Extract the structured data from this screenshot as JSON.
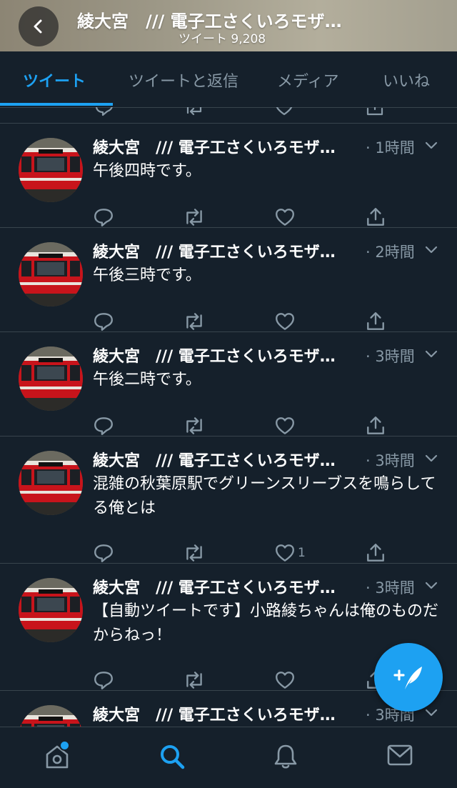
{
  "header": {
    "title": "綾大宮　/// 電子工さくいろモザ…",
    "subtitle": "ツイート 9,208"
  },
  "tabs": [
    {
      "label": "ツイート",
      "active": true
    },
    {
      "label": "ツイートと返信",
      "active": false
    },
    {
      "label": "メディア",
      "active": false
    },
    {
      "label": "いいね",
      "active": false
    }
  ],
  "tweets": [
    {
      "name": "綾大宮　/// 電子工さくいろモザ…",
      "time": "· 1時間",
      "text": "午後四時です。",
      "likes": ""
    },
    {
      "name": "綾大宮　/// 電子工さくいろモザ…",
      "time": "· 2時間",
      "text": "午後三時です。",
      "likes": ""
    },
    {
      "name": "綾大宮　/// 電子工さくいろモザ…",
      "time": "· 3時間",
      "text": "午後二時です。",
      "likes": ""
    },
    {
      "name": "綾大宮　/// 電子工さくいろモザ…",
      "time": "· 3時間",
      "text": "混雑の秋葉原駅でグリーンスリーブスを鳴らしてる俺とは",
      "likes": "1"
    },
    {
      "name": "綾大宮　/// 電子工さくいろモザ…",
      "time": "· 3時間",
      "text": "【自動ツイートです】小路綾ちゃんは俺のものだからねっ！",
      "likes": ""
    },
    {
      "name": "綾大宮　/// 電子工さくいろモザ…",
      "time": "· 3時間",
      "text": "",
      "likes": ""
    }
  ],
  "colors": {
    "background": "#15202b",
    "accent": "#1da1f2",
    "muted": "#8899a6",
    "divider": "#38444d"
  },
  "icons": {
    "back": "chevron-left-icon",
    "reply": "reply-icon",
    "retweet": "retweet-icon",
    "like": "heart-icon",
    "share": "share-icon",
    "compose": "compose-tweet-icon",
    "home": "home-icon",
    "search": "search-icon",
    "notifications": "bell-icon",
    "messages": "mail-icon"
  }
}
